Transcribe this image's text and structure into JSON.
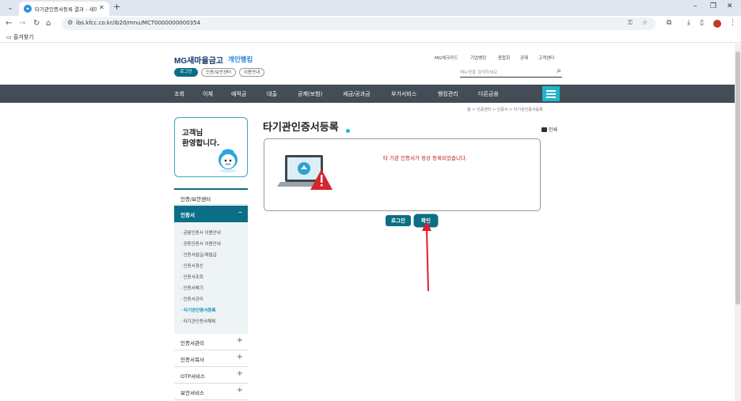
{
  "browser": {
    "tab_title": "타기관인증서등록 결과 - 새마을금고",
    "url": "ibs.kfcc.co.kr/ib20/mnu/MCT0000000000354",
    "bookmark_folder": "즐겨찾기"
  },
  "header": {
    "logo_text": "MG새마을금고",
    "logo_sub": "개인뱅킹",
    "buttons": [
      "로그인",
      "인증/보안센터",
      "이용안내"
    ],
    "util_links": [
      "MG체크카드",
      "기업뱅킹",
      "종합회",
      "공제",
      "고객센터"
    ],
    "search_placeholder": "메뉴명을 검색하세요"
  },
  "gnb": {
    "items": [
      "조회",
      "이체",
      "예적금",
      "대출",
      "공제(보험)",
      "세금/공과금",
      "부가서비스",
      "뱅킹관리",
      "다른금융"
    ]
  },
  "breadcrumb": "홈 > 인증센터 > 인증서 > 타기관인증서등록",
  "sidebar": {
    "welcome_line1": "고객님",
    "welcome_line2": "환영합니다.",
    "section_title": "인증/보안센터",
    "active_menu": "인증서",
    "sub_items": [
      "금융인증서 이용안내",
      "공동인증서 이용안내",
      "인증서발급/재발급",
      "인증서갱신",
      "인증서조회",
      "인증서폐기",
      "인증서관리",
      "타기관인증서등록",
      "타기관인증서해제"
    ],
    "active_sub_index": 7,
    "collapsed_menus": [
      "인증서관리",
      "인증서복사",
      "OTP서비스",
      "보안서비스"
    ]
  },
  "main": {
    "title": "타기관인증서등록",
    "print_label": "인쇄",
    "result_message": "타 기관 인증서가 정상 등록되었습니다.",
    "btn_login": "로그인",
    "btn_confirm": "확인"
  },
  "colors": {
    "primary": "#0a6f86",
    "accent": "#22b5c9",
    "error": "#c0131b",
    "gnb_bg": "#434d57"
  }
}
